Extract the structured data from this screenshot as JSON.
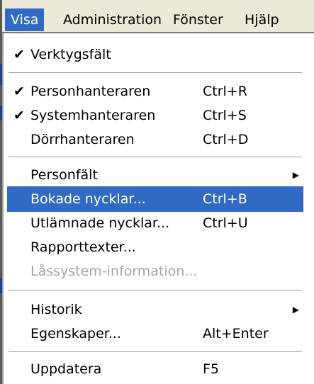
{
  "menubar": {
    "items": [
      {
        "label": "Visa",
        "active": true
      },
      {
        "label": "Administration",
        "active": false
      },
      {
        "label": "Fönster",
        "active": false
      },
      {
        "label": "Hjälp",
        "active": false
      }
    ]
  },
  "menu": {
    "items": [
      {
        "label": "Verktygsfält",
        "check": "✔",
        "shortcut": "",
        "submenu": false
      },
      {
        "label": "Personhanteraren",
        "check": "✔",
        "shortcut": "Ctrl+R",
        "submenu": false
      },
      {
        "label": "Systemhanteraren",
        "check": "✔",
        "shortcut": "Ctrl+S",
        "submenu": false
      },
      {
        "label": "Dörrhanteraren",
        "check": "",
        "shortcut": "Ctrl+D",
        "submenu": false
      },
      {
        "label": "Personfält",
        "check": "",
        "shortcut": "",
        "submenu": true,
        "arrow": "▶"
      },
      {
        "label": "Bokade nycklar...",
        "check": "",
        "shortcut": "Ctrl+B",
        "submenu": false,
        "highlighted": true
      },
      {
        "label": "Utlämnade nycklar...",
        "check": "",
        "shortcut": "Ctrl+U",
        "submenu": false
      },
      {
        "label": "Rapporttexter...",
        "check": "",
        "shortcut": "",
        "submenu": false
      },
      {
        "label": "Låssystem-information...",
        "check": "",
        "shortcut": "",
        "submenu": false,
        "disabled": true
      },
      {
        "label": "Historik",
        "check": "",
        "shortcut": "",
        "submenu": true,
        "arrow": "▶"
      },
      {
        "label": "Egenskaper...",
        "check": "",
        "shortcut": "Alt+Enter",
        "submenu": false
      },
      {
        "label": "Uppdatera",
        "check": "",
        "shortcut": "F5",
        "submenu": false
      }
    ]
  },
  "colors": {
    "highlight": "#316ac5",
    "menubar_bg": "#ece9d8",
    "disabled_text": "#a7a59d"
  }
}
